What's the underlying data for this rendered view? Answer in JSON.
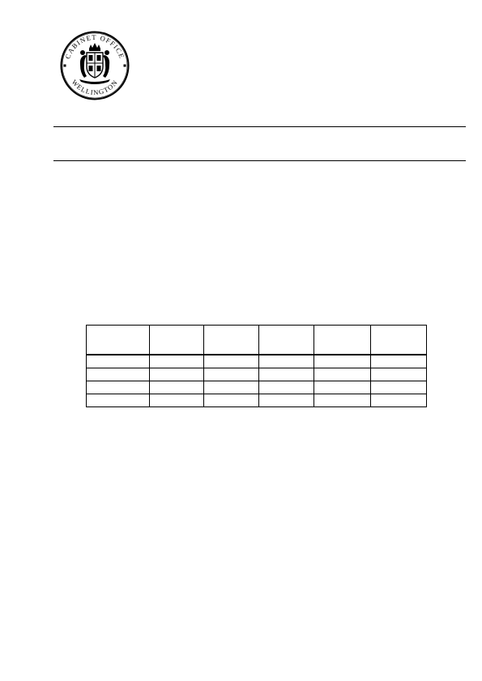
{
  "seal": {
    "text_top": "CABINET OFFICE",
    "text_bottom": "WELLINGTON",
    "icon": "new-zealand-coat-of-arms-icon"
  },
  "table": {
    "headers": [
      "",
      "",
      "",
      "",
      "",
      ""
    ],
    "rows": [
      [
        "",
        "",
        "",
        "",
        "",
        ""
      ],
      [
        "",
        "",
        "",
        "",
        "",
        ""
      ],
      [
        "",
        "",
        "",
        "",
        "",
        ""
      ],
      [
        "",
        "",
        "",
        "",
        "",
        ""
      ]
    ]
  }
}
